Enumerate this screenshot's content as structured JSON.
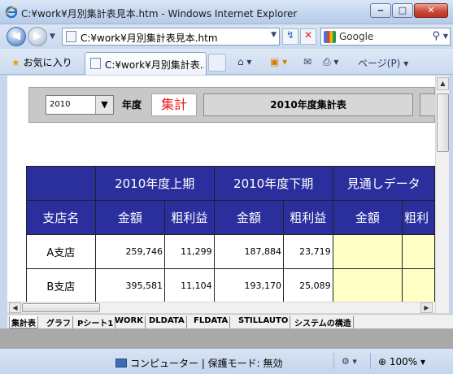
{
  "window": {
    "title": "C:¥work¥月別集計表見本.htm - Windows Internet Explorer",
    "minimize": "‒",
    "maximize": "□",
    "close": "✕"
  },
  "address": {
    "url": "C:¥work¥月別集計表見本.htm",
    "search_placeholder": "Google"
  },
  "command_bar": {
    "favorites_label": "お気に入り",
    "tab_title": "C:¥work¥月別集計表...",
    "page_menu": "ページ(P)"
  },
  "sheet": {
    "year_value": "2010",
    "year_label": "年度",
    "tally_button": "集計",
    "title_button": "2010年度集計表",
    "table": {
      "group_headers": [
        "2010年度上期",
        "2010年度下期",
        "見通しデータ"
      ],
      "sub_headers": [
        "支店名",
        "金額",
        "粗利益",
        "金額",
        "粗利益",
        "金額",
        "粗利"
      ],
      "rows": [
        {
          "name": "A支店",
          "values": [
            "259,746",
            "11,299",
            "187,884",
            "23,719"
          ]
        },
        {
          "name": "B支店",
          "values": [
            "395,581",
            "11,104",
            "193,170",
            "25,089"
          ]
        }
      ]
    }
  },
  "sheet_tabs": [
    "集計表",
    "グラフ",
    "Pシート1",
    "WORK",
    "DLDATA",
    "FLDATA",
    "STILLAUTO",
    "システムの構造"
  ],
  "status": {
    "zone_text": "コンピューター | 保護モード: 無効",
    "zoom": "100%"
  },
  "colors": {
    "header_blue": "#2b2f9e",
    "forecast_yellow": "#ffffc6",
    "tally_red": "#e81c1c"
  },
  "icons": [
    "ie-logo-icon",
    "back-icon",
    "forward-icon",
    "refresh-icon",
    "stop-icon",
    "google-icon",
    "search-icon",
    "favorites-star-icon",
    "home-icon",
    "rss-icon",
    "mail-icon",
    "print-icon",
    "computer-icon",
    "zoom-icon"
  ]
}
